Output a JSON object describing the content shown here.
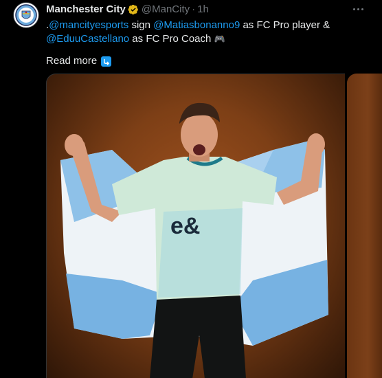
{
  "tweet": {
    "display_name": "Manchester City",
    "handle": "@ManCity",
    "separator": "·",
    "time": "1h",
    "text_parts": {
      "prefix": ".",
      "mention_esports": "@mancityesports",
      "mid1": " sign ",
      "mention_player": "@Matiasbonanno9",
      "mid2": " as FC Pro player & ",
      "mention_coach": "@EduuCastellano",
      "suffix": " as FC Pro Coach ",
      "emoji": "🎮"
    },
    "read_more": "Read more",
    "colors": {
      "background": "#000000",
      "text": "#e7e9ea",
      "secondary": "#71767b",
      "link": "#1d9bf0"
    }
  },
  "icons": {
    "avatar": "manchester-city-crest-icon",
    "verified": "verified-badge-icon",
    "more": "more-options-icon",
    "read_more": "arrow-right-hook-icon"
  },
  "media": {
    "kit_sponsor": "e&"
  }
}
